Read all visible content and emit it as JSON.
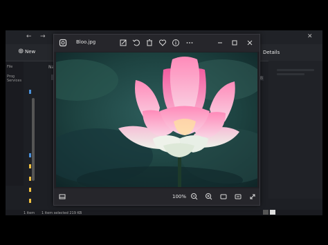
{
  "explorer": {
    "toolbar": {
      "new_label": "New",
      "details_label": "Details"
    },
    "sidebar": {
      "labels": [
        "File",
        "Prog",
        "Services"
      ]
    },
    "column_header": "Na",
    "size_label": "KB",
    "status": {
      "items": "1 item",
      "selected": "1 item selected  219 KB"
    }
  },
  "viewer": {
    "title": "Bloo.jpg",
    "zoom": "100%",
    "toolbar_icons": [
      "edit-icon",
      "rotate-icon",
      "delete-icon",
      "favorite-icon",
      "info-icon",
      "more-icon"
    ],
    "window_controls": [
      "minimize-icon",
      "maximize-icon",
      "close-icon"
    ],
    "bottom_icons": [
      "filmstrip-icon",
      "zoom-out-icon",
      "zoom-in-icon",
      "fit-window-icon",
      "actual-size-icon",
      "fullscreen-icon"
    ],
    "accent_color": "#ff89b8"
  }
}
